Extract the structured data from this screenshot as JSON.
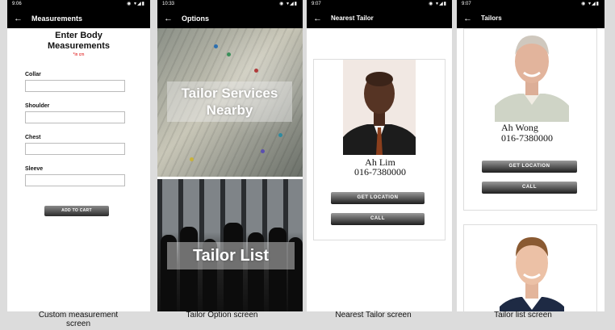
{
  "screens": [
    {
      "status_time": "9:06",
      "title": "Measurements",
      "heading": "Enter Body Measurements",
      "unit_note": "*in cm",
      "fields": [
        "Collar",
        "Shoulder",
        "Chest",
        "Sleeve"
      ],
      "button": "ADD TO CART",
      "caption": "Custom measurement screen"
    },
    {
      "status_time": "10:33",
      "title": "Options",
      "option1": "Tailor Services Nearby",
      "option2": "Tailor List",
      "caption": "Tailor Option screen"
    },
    {
      "status_time": "9:07",
      "title": "Nearest Tailor",
      "name": "Ah Lim",
      "phone": "016-7380000",
      "btn_location": "GET LOCATION",
      "btn_call": "CALL",
      "caption": "Nearest Tailor screen"
    },
    {
      "status_time": "9:07",
      "title": "Tailors",
      "name": "Ah Wong",
      "phone": "016-7380000",
      "btn_location": "GET LOCATION",
      "btn_call": "CALL",
      "caption": "Tailor list screen"
    }
  ],
  "icons": {
    "back": "arrow-left-icon",
    "status": "wifi-signal-battery-icons"
  }
}
